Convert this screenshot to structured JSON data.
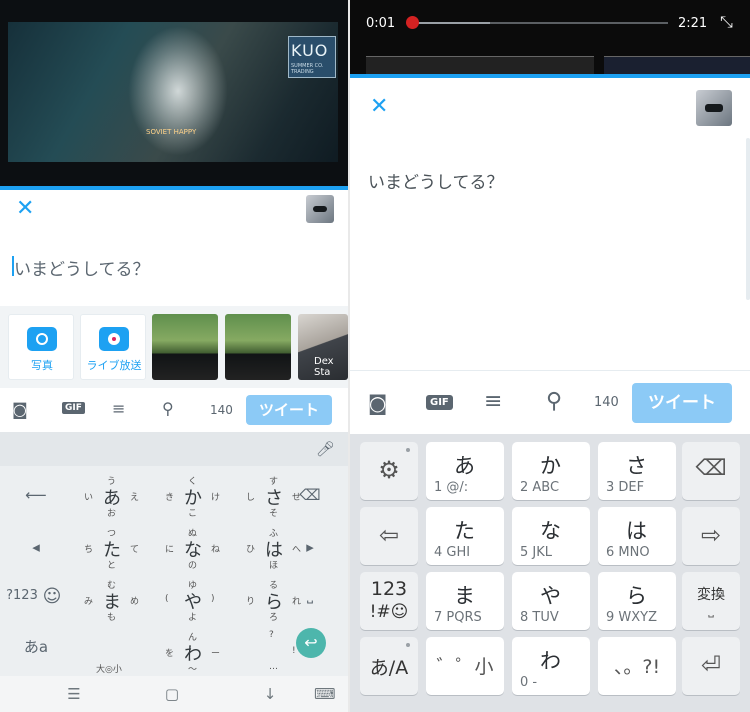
{
  "left": {
    "video_text": {
      "sign": "KUO",
      "sign_sub": "SUMMER CO. TRADING",
      "overlay": "SOVIET HAPPY"
    },
    "compose": {
      "placeholder": "いまどうしてる？"
    },
    "media_tiles": [
      {
        "label": "写真"
      },
      {
        "label": "ライブ放送"
      }
    ],
    "dex_label": "Dex Sta",
    "toolbar": {
      "gif": "GIF",
      "count": "140",
      "tweet": "ツイート"
    },
    "keyboard": {
      "keys": [
        {
          "main": "あ",
          "u": "う",
          "l": "い",
          "r": "え",
          "d": "お"
        },
        {
          "main": "か",
          "u": "く",
          "l": "き",
          "r": "け",
          "d": "こ"
        },
        {
          "main": "さ",
          "u": "す",
          "l": "し",
          "r": "せ",
          "d": "そ"
        },
        {
          "main": "た",
          "u": "つ",
          "l": "ち",
          "r": "て",
          "d": "と"
        },
        {
          "main": "な",
          "u": "ぬ",
          "l": "に",
          "r": "ね",
          "d": "の"
        },
        {
          "main": "は",
          "u": "ふ",
          "l": "ひ",
          "r": "へ",
          "d": "ほ"
        },
        {
          "main": "ま",
          "u": "む",
          "l": "み",
          "r": "め",
          "d": "も"
        },
        {
          "main": "や",
          "u": "ゆ",
          "l": "(",
          "r": ")",
          "d": "よ"
        },
        {
          "main": "ら",
          "u": "る",
          "l": "り",
          "r": "れ",
          "d": "ろ"
        },
        {
          "main": "",
          "u": "",
          "l": "",
          "r": "",
          "d": "大◎小"
        },
        {
          "main": "わ",
          "u": "ん",
          "l": "を",
          "r": "ー",
          "d": "〜"
        },
        {
          "main": "",
          "u": "?",
          "l": "",
          "r": "!",
          "d": "…"
        }
      ],
      "side_left": [
        "⟵",
        "◂",
        "?123",
        "あa"
      ],
      "side_right": [
        "⌫",
        "▸",
        "⎵"
      ],
      "emoji": "☺"
    }
  },
  "right": {
    "player": {
      "current": "0:01",
      "total": "2:21",
      "progress": 0.007
    },
    "compose": {
      "placeholder": "いまどうしてる？"
    },
    "toolbar": {
      "gif": "GIF",
      "count": "140",
      "tweet": "ツイート"
    },
    "keyboard": {
      "rows": [
        [
          {
            "main": "あ",
            "sub": "1   @/:"
          },
          {
            "main": "か",
            "sub": "2    ABC"
          },
          {
            "main": "さ",
            "sub": "3    DEF"
          }
        ],
        [
          {
            "main": "た",
            "sub": "4    GHI"
          },
          {
            "main": "な",
            "sub": "5    JKL"
          },
          {
            "main": "は",
            "sub": "6   MNO"
          }
        ],
        [
          {
            "main": "ま",
            "sub": "7   PQRS"
          },
          {
            "main": "や",
            "sub": "8    TUV"
          },
          {
            "main": "ら",
            "sub": "9   WXYZ"
          }
        ],
        [
          {
            "main": "゛゜小",
            "sub": ""
          },
          {
            "main": "わ",
            "sub": "0        ‐"
          },
          {
            "main": "、。?!",
            "sub": ""
          }
        ]
      ],
      "sym123": "123",
      "sym_symbols": "!#☺",
      "henkan": "変換",
      "mode": "あ/A"
    }
  }
}
